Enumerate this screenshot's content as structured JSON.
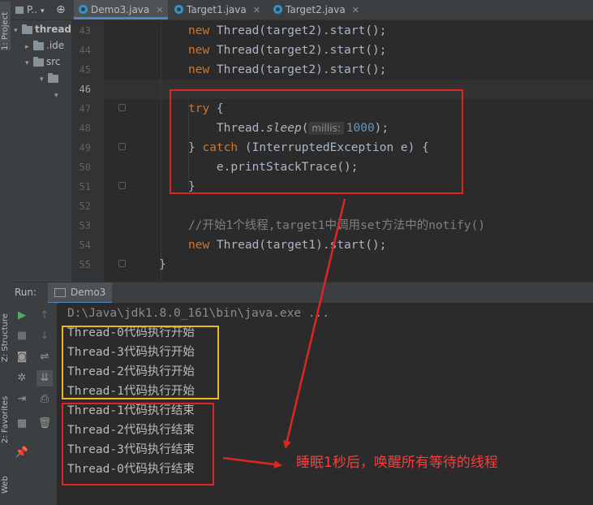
{
  "left_stripe": {
    "project_label": "1: Project",
    "structure_label": "Z: Structure",
    "favorites_label": "2: Favorites",
    "web_label": "Web"
  },
  "tabs": [
    {
      "label": "P..",
      "icon": "project-icon"
    },
    {
      "label": "Demo3.java",
      "icon": "java-class-icon",
      "active": true
    },
    {
      "label": "Target1.java",
      "icon": "java-class-icon"
    },
    {
      "label": "Target2.java",
      "icon": "java-class-icon"
    }
  ],
  "project_tree": [
    {
      "label": "thread",
      "icon": "folder-icon"
    },
    {
      "label": ".ide",
      "icon": "folder-icon"
    },
    {
      "label": "src",
      "icon": "folder-icon"
    }
  ],
  "editor": {
    "line_numbers": [
      "43",
      "44",
      "45",
      "46",
      "47",
      "48",
      "49",
      "50",
      "51",
      "52",
      "53",
      "54",
      "55"
    ],
    "lines": [
      {
        "n": "43",
        "tokens": [
          [
            "kw",
            "new "
          ],
          [
            "",
            "Thread(target2).start();"
          ]
        ]
      },
      {
        "n": "44",
        "tokens": [
          [
            "kw",
            "new "
          ],
          [
            "",
            "Thread(target2).start();"
          ]
        ]
      },
      {
        "n": "45",
        "tokens": [
          [
            "kw",
            "new "
          ],
          [
            "",
            "Thread(target2).start();"
          ]
        ]
      },
      {
        "n": "46",
        "tokens": []
      },
      {
        "n": "47",
        "tokens": [
          [
            "kw",
            "try "
          ],
          [
            "",
            "{"
          ]
        ]
      },
      {
        "n": "48",
        "tokens": [
          [
            "",
            "    Thread."
          ],
          [
            "it",
            "sleep"
          ],
          [
            "",
            "("
          ],
          [
            "hint",
            "millis:"
          ],
          [
            "num",
            "1000"
          ],
          [
            "",
            ");"
          ]
        ]
      },
      {
        "n": "49",
        "tokens": [
          [
            "",
            "} "
          ],
          [
            "kw",
            "catch "
          ],
          [
            "",
            "(InterruptedException e) {"
          ]
        ]
      },
      {
        "n": "50",
        "tokens": [
          [
            "",
            "    e.printStackTrace();"
          ]
        ]
      },
      {
        "n": "51",
        "tokens": [
          [
            "",
            "}"
          ]
        ]
      },
      {
        "n": "52",
        "tokens": []
      },
      {
        "n": "53",
        "tokens": [
          [
            "cmt",
            "//开始1个线程,target1中调用set方法中的notify()"
          ]
        ]
      },
      {
        "n": "54",
        "tokens": [
          [
            "kw",
            "new "
          ],
          [
            "",
            "Thread(target1).start();"
          ]
        ]
      },
      {
        "n": "55",
        "tokens": [
          [
            "",
            "}"
          ]
        ]
      }
    ]
  },
  "run_panel": {
    "run_label": "Run:",
    "tab_label": "Demo3",
    "command_line": "D:\\Java\\jdk1.8.0_161\\bin\\java.exe ...",
    "output": [
      "Thread-0代码执行开始",
      "Thread-3代码执行开始",
      "Thread-2代码执行开始",
      "Thread-1代码执行开始",
      "Thread-1代码执行结束",
      "Thread-2代码执行结束",
      "Thread-3代码执行结束",
      "Thread-0代码执行结束"
    ]
  },
  "annotation": {
    "text": "睡眠1秒后，唤醒所有等待的线程",
    "color": "#ff3b3b"
  },
  "colors": {
    "keyword": "#cc7832",
    "number": "#6897bb",
    "comment": "#808080",
    "default_text": "#a9b7c6",
    "red_box": "#e02424",
    "yellow_box": "#f2b51e"
  }
}
